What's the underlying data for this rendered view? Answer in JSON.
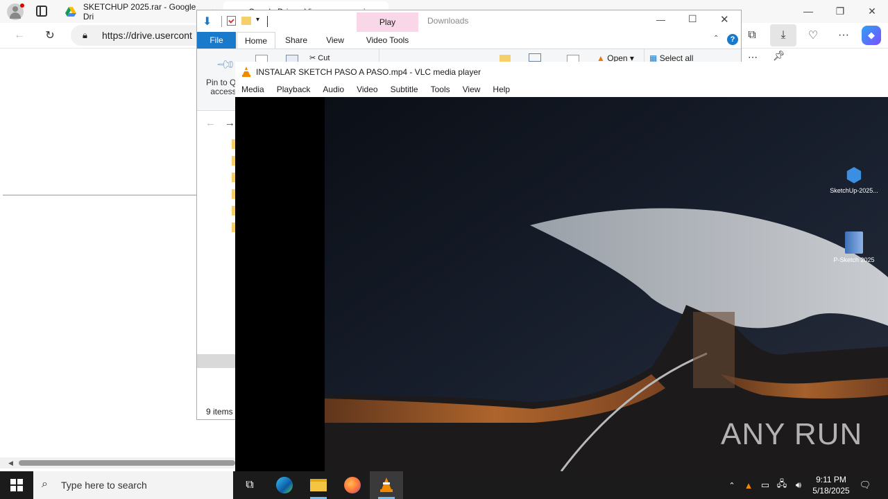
{
  "browser": {
    "tab1_title": "SKETCHUP 2025.rar - Google Dri",
    "tab2_title": "Google Drive - Virus scan warni",
    "url": "https://drive.usercont",
    "more_label": "···"
  },
  "explorer": {
    "title": "Downloads",
    "context_tab": "Play",
    "tabs": [
      "File",
      "Home",
      "Share",
      "View",
      "Video Tools"
    ],
    "ribbon": {
      "pin_line1": "Pin to Qu",
      "pin_line2": "access",
      "cut": "Cut",
      "open": "Open",
      "select_all": "Select all"
    },
    "status": "9 items"
  },
  "vlc": {
    "title": "INSTALAR SKETCH PASO A PASO.mp4 - VLC media player",
    "menu": [
      "Media",
      "Playback",
      "Audio",
      "Video",
      "Subtitle",
      "Tools",
      "View",
      "Help"
    ],
    "watermark": "ANY RUN"
  },
  "desktop": {
    "icons": [
      {
        "label": "SketchUp-2025...",
        "icon": "sketchup-icon"
      },
      {
        "label": "P-Sketch 2025",
        "icon": "rar-archive-icon"
      }
    ]
  },
  "taskbar": {
    "search_placeholder": "Type here to search",
    "time": "9:11 PM",
    "date": "5/18/2025"
  },
  "colors": {
    "accent": "#1979ca",
    "play_context": "#f9d7e8",
    "taskbar": "#1b1b1b"
  }
}
